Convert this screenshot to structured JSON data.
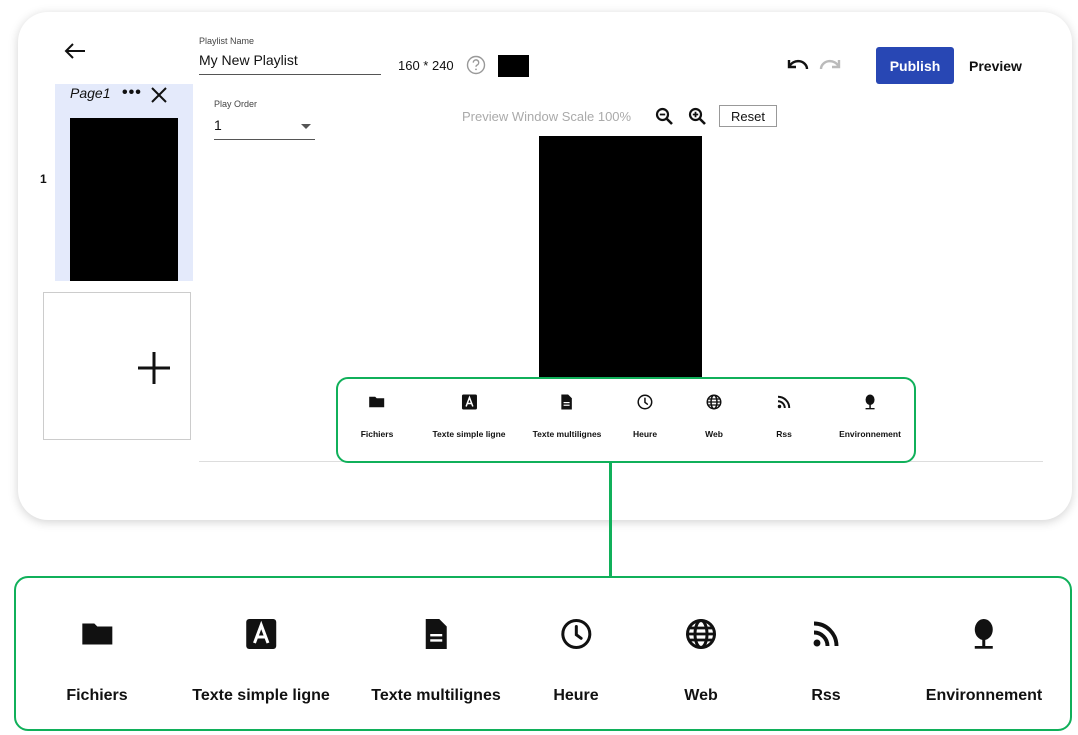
{
  "editor": {
    "playlist_name_label": "Playlist Name",
    "playlist_name_value": "My New Playlist",
    "resolution": "160 * 240",
    "play_order_label": "Play Order",
    "play_order_value": "1",
    "preview_scale_label": "Preview Window Scale",
    "preview_scale_value": "100%",
    "reset_label": "Reset",
    "publish_label": "Publish",
    "preview_label": "Preview",
    "background_color": "#000000",
    "accent_color": "#2847b4"
  },
  "pages": {
    "items": [
      {
        "title": "Page1",
        "more": "•••",
        "number": "1"
      }
    ]
  },
  "toolbar": {
    "highlight_color": "#10b05a",
    "items": [
      {
        "label": "Fichiers",
        "icon": "folder-icon"
      },
      {
        "label": "Texte simple ligne",
        "icon": "text-a-icon"
      },
      {
        "label": "Texte multilignes",
        "icon": "document-icon"
      },
      {
        "label": "Heure",
        "icon": "clock-icon"
      },
      {
        "label": "Web",
        "icon": "globe-icon"
      },
      {
        "label": "Rss",
        "icon": "rss-icon"
      },
      {
        "label": "Environnement",
        "icon": "tree-icon"
      }
    ]
  }
}
